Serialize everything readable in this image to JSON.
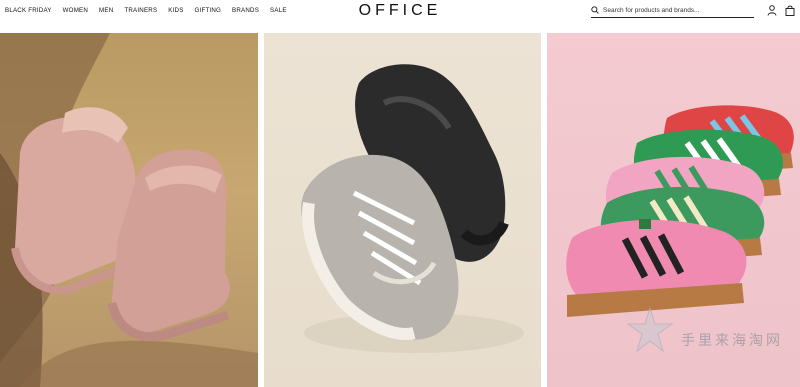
{
  "nav": {
    "items": [
      "BLACK FRIDAY",
      "WOMEN",
      "MEN",
      "TRAINERS",
      "KIDS",
      "GIFTING",
      "BRANDS",
      "SALE"
    ]
  },
  "brand": {
    "logo": "OFFICE"
  },
  "search": {
    "placeholder": "Search for products and brands..."
  },
  "watermark": {
    "text": "手里来海淘网"
  },
  "colors": {
    "boots": "#d9a9a0",
    "boot_shadow": "#b88a82",
    "silver_sneaker": "#b8b4ad",
    "black_sneaker": "#2b2b2b",
    "pink_sneaker": "#f08ab1",
    "green_sneaker": "#3c9a5e",
    "red_sneaker": "#e04545"
  }
}
